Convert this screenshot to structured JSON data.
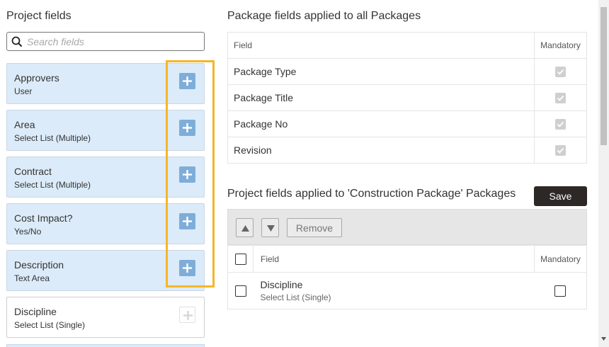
{
  "left": {
    "title": "Project fields",
    "search_placeholder": "Search fields",
    "fields": [
      {
        "name": "Approvers",
        "type": "User"
      },
      {
        "name": "Area",
        "type": "Select List (Multiple)"
      },
      {
        "name": "Contract",
        "type": "Select List (Multiple)"
      },
      {
        "name": "Cost Impact?",
        "type": "Yes/No"
      },
      {
        "name": "Description",
        "type": "Text Area"
      },
      {
        "name": "Discipline",
        "type": "Select List (Single)"
      }
    ]
  },
  "package_fields": {
    "title": "Package fields applied to all Packages",
    "header_field": "Field",
    "header_mandatory": "Mandatory",
    "rows": [
      "Package Type",
      "Package Title",
      "Package No",
      "Revision"
    ]
  },
  "project_fields": {
    "title": "Project fields applied to 'Construction Package' Packages",
    "save_label": "Save",
    "remove_label": "Remove",
    "header_field": "Field",
    "header_mandatory": "Mandatory",
    "rows": [
      {
        "name": "Discipline",
        "type": "Select List (Single)"
      }
    ]
  },
  "colors": {
    "card_bg": "#dcebf9",
    "add_button": "#7fadd9",
    "highlight": "#f5b62a",
    "save_button": "#2d2825"
  }
}
